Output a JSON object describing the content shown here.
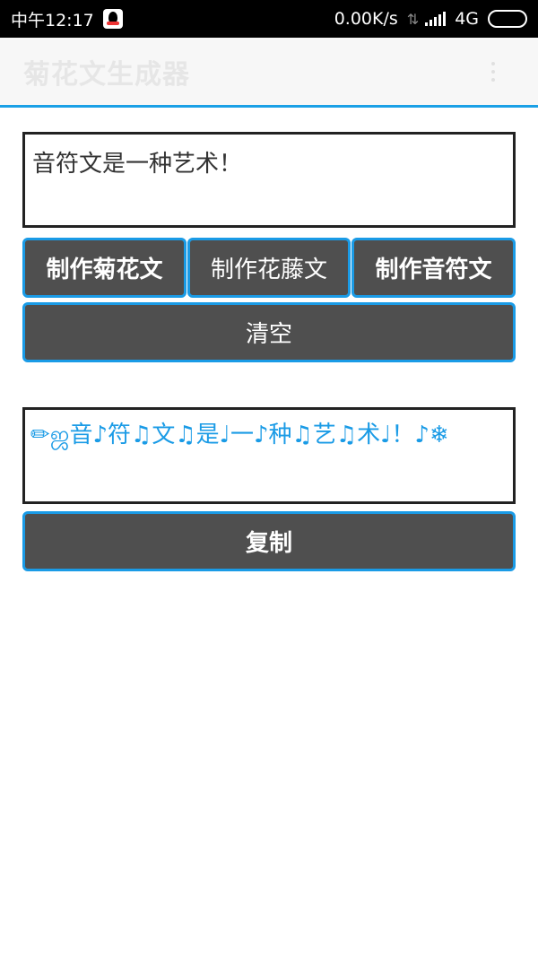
{
  "status_bar": {
    "time": "中午12:17",
    "speed": "0.00K/s",
    "network": "4G"
  },
  "app_bar": {
    "title": "菊花文生成器"
  },
  "input": {
    "value": "音符文是一种艺术！"
  },
  "buttons": {
    "chrysanthemum": "制作菊花文",
    "vine": "制作花藤文",
    "note": "制作音符文",
    "clear": "清空",
    "copy": "复制"
  },
  "output": {
    "value": "✏ஜ音♪符♫文♫是♩一♪种♫艺♫术♩！♪❄"
  },
  "colors": {
    "accent": "#1a9be6",
    "button_bg": "#4f4f4f",
    "status_bg": "#000000"
  }
}
